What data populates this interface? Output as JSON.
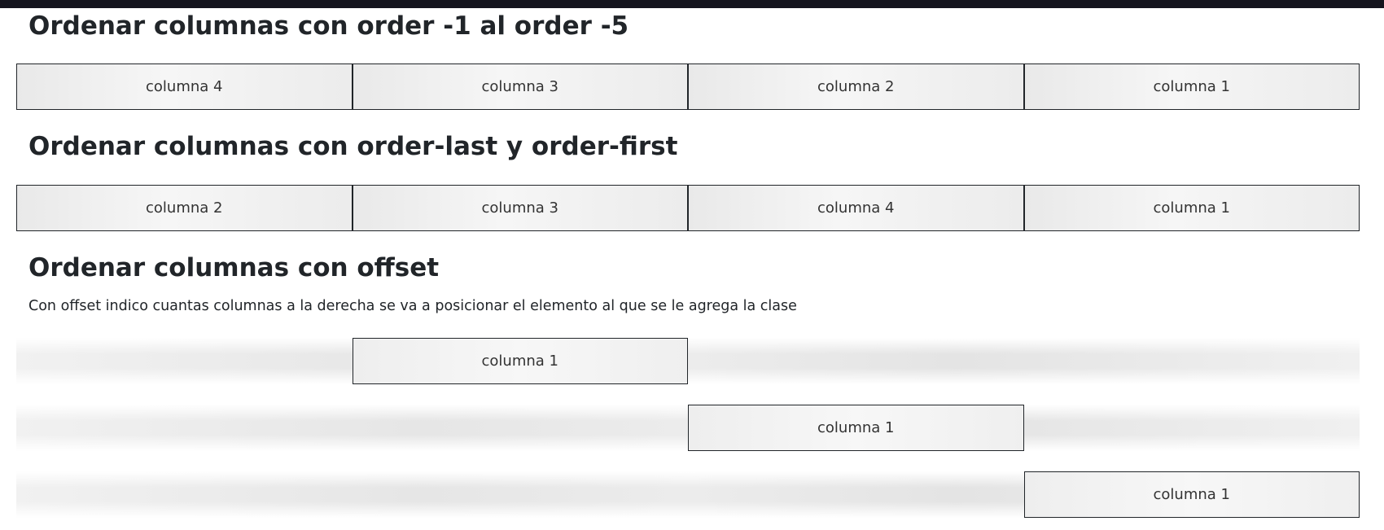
{
  "section_order_numbers": {
    "title": "Ordenar columnas con order -1 al order -5",
    "columns": [
      "columna 4",
      "columna 3",
      "columna 2",
      "columna 1"
    ]
  },
  "section_order_last_first": {
    "title": "Ordenar columnas con order-last y order-first",
    "columns": [
      "columna 2",
      "columna 3",
      "columna 4",
      "columna 1"
    ]
  },
  "section_offset": {
    "title": "Ordenar columnas con offset",
    "description": "Con offset indico cuantas columnas a la derecha se va a posicionar el elemento al que se le agrega la clase",
    "rows": [
      {
        "label": "columna 1",
        "offset": 1
      },
      {
        "label": "columna 1",
        "offset": 2
      },
      {
        "label": "columna 1",
        "offset": 3
      }
    ]
  }
}
